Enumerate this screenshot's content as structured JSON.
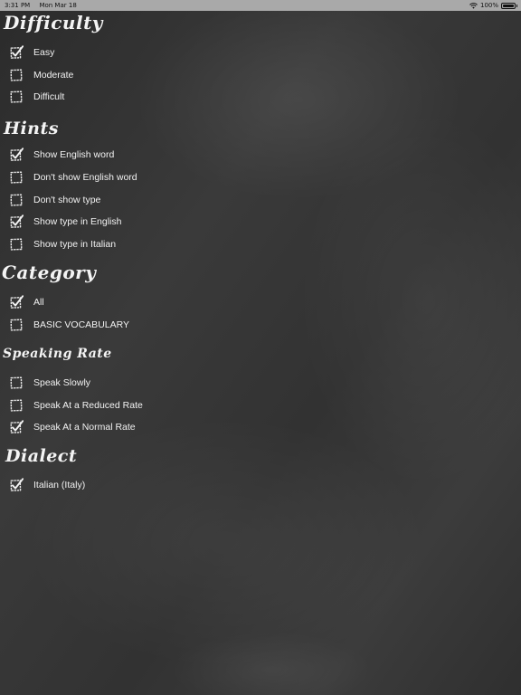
{
  "status_bar": {
    "time": "3:31 PM",
    "date": "Mon Mar 18",
    "battery": "100%",
    "wifi_icon": "wifi-icon",
    "battery_icon": "battery-icon"
  },
  "sections": {
    "difficulty": {
      "title": "Difficulty",
      "options": [
        {
          "label": "Easy",
          "checked": true
        },
        {
          "label": "Moderate",
          "checked": false
        },
        {
          "label": "Difficult",
          "checked": false
        }
      ]
    },
    "hints": {
      "title": "Hints",
      "options": [
        {
          "label": "Show English word",
          "checked": true
        },
        {
          "label": "Don't show English word",
          "checked": false
        },
        {
          "label": "Don't show type",
          "checked": false
        },
        {
          "label": "Show type in English",
          "checked": true
        },
        {
          "label": "Show type in Italian",
          "checked": false
        }
      ]
    },
    "category": {
      "title": "Category",
      "options": [
        {
          "label": "All",
          "checked": true
        },
        {
          "label": "BASIC VOCABULARY",
          "checked": false
        }
      ]
    },
    "speaking_rate": {
      "title": "Speaking Rate",
      "options": [
        {
          "label": "Speak Slowly",
          "checked": false
        },
        {
          "label": "Speak At a Reduced Rate",
          "checked": false
        },
        {
          "label": "Speak At a Normal Rate",
          "checked": true
        }
      ]
    },
    "dialect": {
      "title": "Dialect",
      "options": [
        {
          "label": "Italian (Italy)",
          "checked": true
        }
      ]
    }
  },
  "icons": {
    "checked": "checked-checkbox-icon",
    "unchecked": "unchecked-checkbox-icon"
  }
}
